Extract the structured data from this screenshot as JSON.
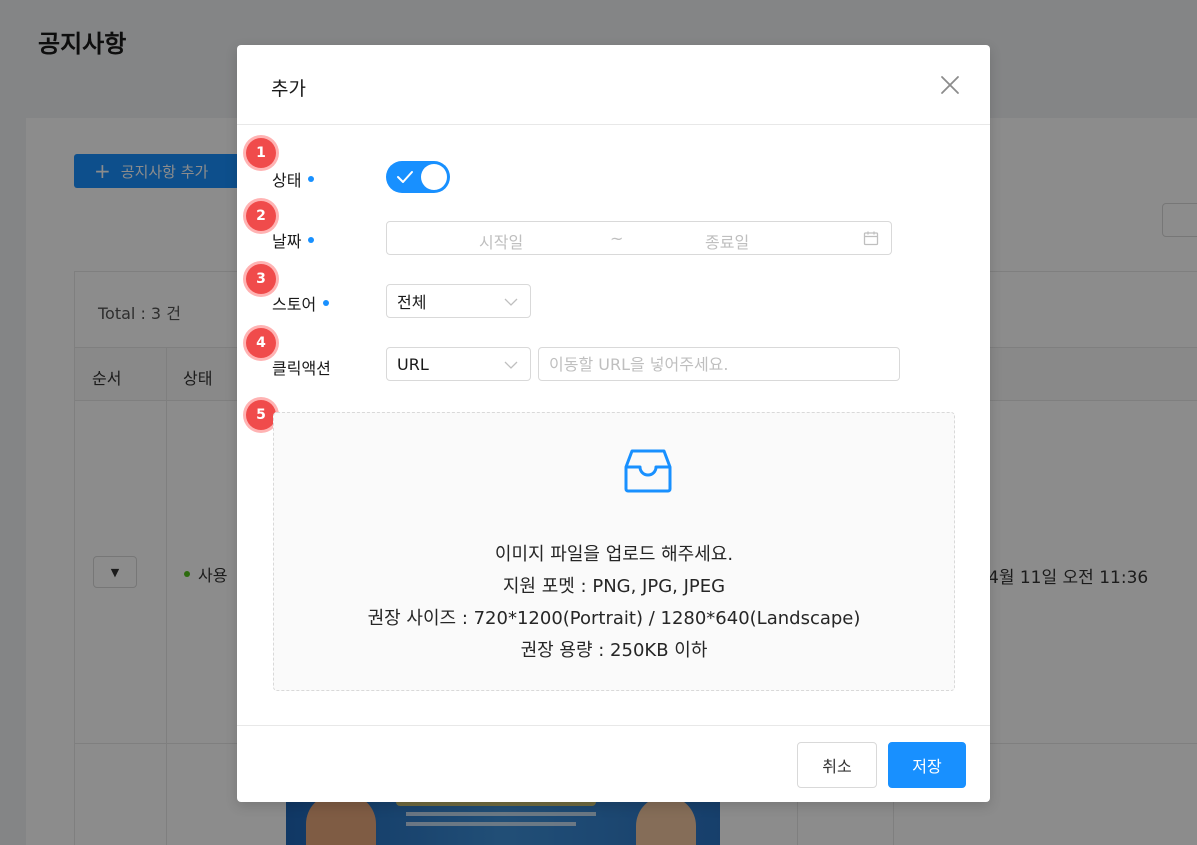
{
  "page": {
    "title": "공지사항",
    "add_button": "공지사항 추가",
    "total": "Total : 3 건",
    "table_headers": [
      "순서",
      "상태"
    ],
    "row": {
      "status": "사용",
      "date": "4월 11일 오전 11:36"
    }
  },
  "modal": {
    "title": "추가",
    "steps": [
      "1",
      "2",
      "3",
      "4",
      "5"
    ],
    "fields": {
      "status": {
        "label": "상태",
        "checked": true
      },
      "date": {
        "label": "날짜",
        "start_placeholder": "시작일",
        "separator": "~",
        "end_placeholder": "종료일"
      },
      "store": {
        "label": "스토어",
        "value": "전체"
      },
      "click_action": {
        "label": "클릭액션",
        "value": "URL",
        "url_placeholder": "이동할 URL을 넣어주세요."
      }
    },
    "upload": {
      "line1": "이미지 파일을 업로드 해주세요.",
      "line2": "지원 포멧 : PNG, JPG, JPEG",
      "line3": "권장 사이즈 : 720*1200(Portrait) / 1280*640(Landscape)",
      "line4": "권장 용량 : 250KB 이하"
    },
    "buttons": {
      "cancel": "취소",
      "save": "저장"
    }
  },
  "colors": {
    "primary": "#1890ff",
    "step_badge": "#f04b4b",
    "status_dot": "#52c41a"
  },
  "icons": [
    "close-icon",
    "check-icon",
    "calendar-icon",
    "chevron-down-icon",
    "inbox-icon",
    "plus-icon",
    "caret-down-icon"
  ]
}
